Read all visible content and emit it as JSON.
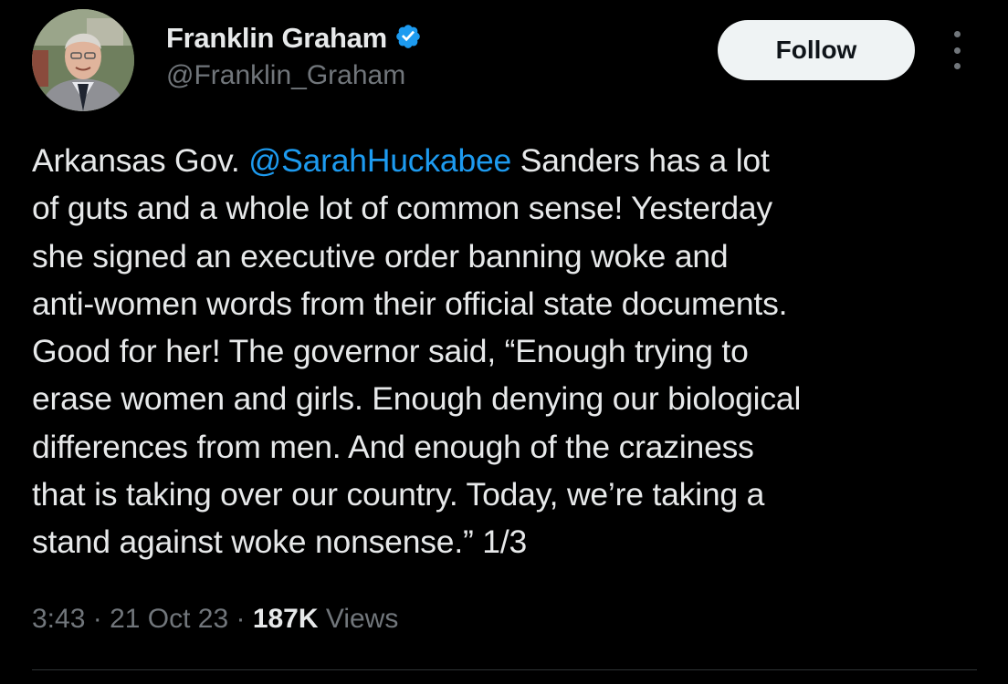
{
  "author": {
    "display_name": "Franklin Graham",
    "handle": "@Franklin_Graham",
    "verified": true
  },
  "actions": {
    "follow_label": "Follow",
    "more_icon": "more-vertical-icon"
  },
  "tweet": {
    "lines": [
      {
        "before": "Arkansas Gov. ",
        "mention": "@SarahHuckabee",
        "after": " Sanders has a lot"
      },
      {
        "text": "of guts and a whole lot of common sense! Yesterday"
      },
      {
        "text": "she signed an executive order banning woke and"
      },
      {
        "text": "anti-women words from their official state documents."
      },
      {
        "text": "Good for her! The governor said, “Enough trying to"
      },
      {
        "text": "erase women and girls. Enough denying our biological"
      },
      {
        "text": "differences from men. And enough of the craziness"
      },
      {
        "text": "that is taking over our country. Today, we’re taking a"
      },
      {
        "text": "stand against woke nonsense.” 1/3"
      }
    ]
  },
  "meta": {
    "time": "3:43",
    "separator": " · ",
    "date": "21 Oct 23",
    "views_count": "187K",
    "views_label": " Views"
  },
  "colors": {
    "background": "#000000",
    "text": "#e7e9ea",
    "secondary": "#71767b",
    "link": "#1d9bf0",
    "verified": "#1d9bf0",
    "follow_bg": "#eff3f4"
  }
}
